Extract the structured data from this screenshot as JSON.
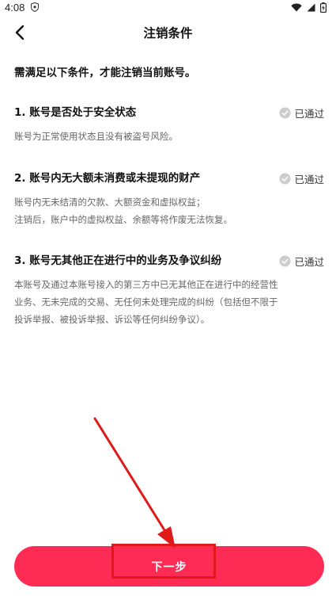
{
  "status_bar": {
    "time": "4:08",
    "icons": [
      "shield-icon",
      "wifi-icon",
      "signal-icon",
      "battery-icon"
    ]
  },
  "nav": {
    "title": "注销条件",
    "back_icon": "chevron-left-icon"
  },
  "intro": "需满足以下条件，才能注销当前账号。",
  "conditions": [
    {
      "title": "1. 账号是否处于安全状态",
      "status": "已通过",
      "description_lines": [
        "账号为正常使用状态且没有被盗号风险。"
      ]
    },
    {
      "title": "2. 账号内无大额未消费或未提现的财产",
      "status": "已通过",
      "description_lines": [
        "账号内无未结清的欠款、大额资金和虚拟权益；",
        "注销后，账户中的虚拟权益、余额等将作废无法恢复。"
      ]
    },
    {
      "title": "3. 账号无其他正在进行中的业务及争议纠纷",
      "status": "已通过",
      "description_lines": [
        "本账号及通过本账号接入的第三方中已无其他正在进行中的经营性",
        "业务、无未完成的交易、无任何未处理完成的纠纷（包括但不限于",
        "投诉举报、被投诉举报、诉讼等任何纠纷争议）。"
      ]
    }
  ],
  "next_button": {
    "label": "下一步"
  },
  "colors": {
    "accent": "#fe2c55",
    "annotation": "#e01919",
    "passed_check": "#cccccc"
  }
}
